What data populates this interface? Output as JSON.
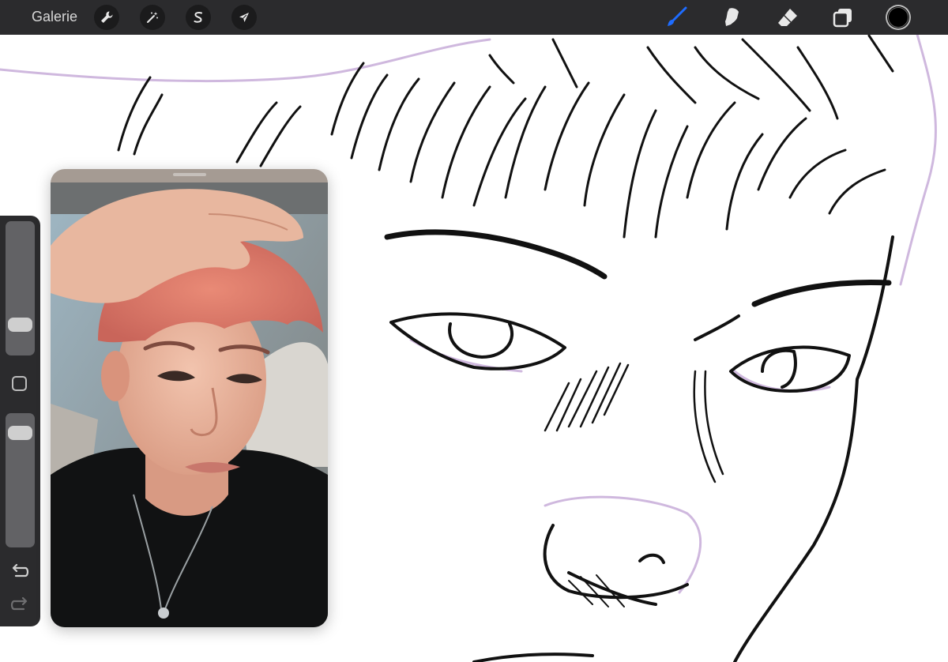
{
  "toolbar": {
    "gallery_label": "Galerie",
    "left_tools": [
      {
        "name": "actions",
        "icon": "wrench-icon"
      },
      {
        "name": "adjustments",
        "icon": "magic-wand-icon"
      },
      {
        "name": "selection",
        "icon": "selection-s-icon"
      },
      {
        "name": "transform",
        "icon": "arrow-cursor-icon"
      }
    ],
    "right_tools": [
      {
        "name": "brush",
        "icon": "brush-icon",
        "active": true
      },
      {
        "name": "smudge",
        "icon": "smudge-finger-icon",
        "active": false
      },
      {
        "name": "eraser",
        "icon": "eraser-icon",
        "active": false
      },
      {
        "name": "layers",
        "icon": "layers-icon",
        "active": false
      }
    ],
    "current_color": "#000000",
    "accent_color": "#1e6cff"
  },
  "sidebar": {
    "brush_size_level": 0.18,
    "opacity_level": 0.92,
    "modify_icon": "square-icon",
    "undo_icon": "undo-arrow-icon",
    "redo_icon": "redo-arrow-icon"
  },
  "reference_window": {
    "content": "photo-reference",
    "handle_icon": "drag-handle-icon"
  }
}
